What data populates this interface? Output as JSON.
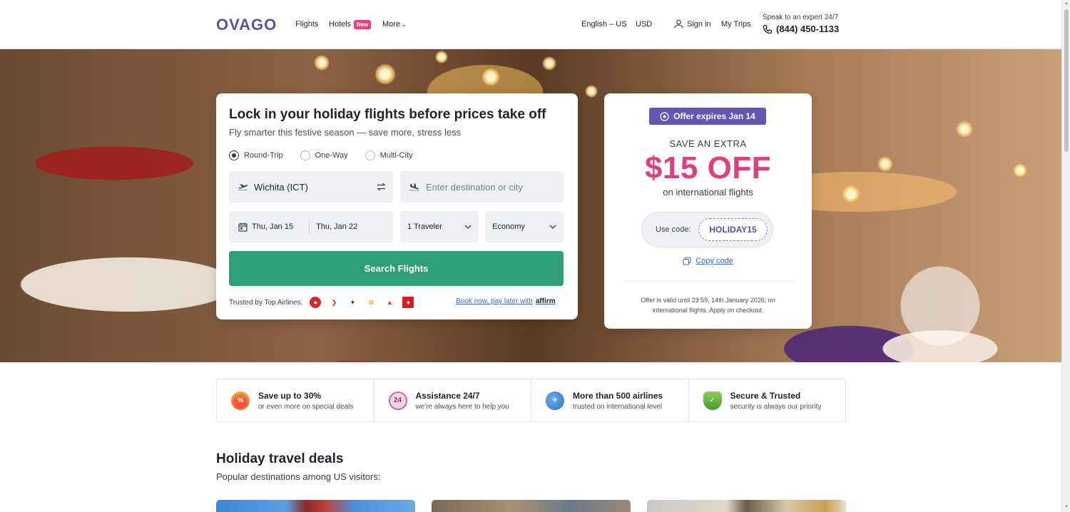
{
  "header": {
    "logo": "OVAGO",
    "nav": [
      {
        "label": "Flights"
      },
      {
        "label": "Hotels",
        "badge": "New"
      },
      {
        "label": "More"
      }
    ],
    "language": "English – US",
    "currency": "USD",
    "sign_in": "Sign in",
    "my_trips": "My Trips",
    "phone_caption": "Speak to an expert 24/7",
    "phone_number": "(844) 450-1133"
  },
  "search": {
    "title": "Lock in your holiday flights before prices take off",
    "subtitle": "Fly smarter this festive season — save more, stress less",
    "trip_types": [
      "Round-Trip",
      "One-Way",
      "Multi-City"
    ],
    "selected_trip_type": "Round-Trip",
    "origin_value": "Wichita (ICT)",
    "destination_placeholder": "Enter destination or city",
    "depart_date": "Thu, Jan 15",
    "return_date": "Thu, Jan 22",
    "travelers": "1 Traveler",
    "cabin_class": "Economy",
    "search_button": "Search Flights",
    "trusted_label": "Trusted by Top Airlines:",
    "book_later": "Book now, pay later with",
    "affirm": "affirm"
  },
  "airlines": [
    {
      "icon": "turkish-airlines-logo",
      "color": "#d7262e"
    },
    {
      "icon": "airline-logo-2",
      "color": "#d62c2c"
    },
    {
      "icon": "qatar-airways-logo",
      "color": "#5c0632"
    },
    {
      "icon": "singapore-airlines-logo",
      "color": "#f2a53a"
    },
    {
      "icon": "austrian-airlines-logo",
      "color": "#e03a3a"
    },
    {
      "icon": "emirates-logo",
      "color": "#d71a21"
    }
  ],
  "promo": {
    "offer_badge": "Offer expires Jan 14",
    "save_extra": "SAVE AN EXTRA",
    "amount": "$15 OFF",
    "scope": "on international flights",
    "use_code_label": "Use code:",
    "code": "HOLIDAY15",
    "copy_label": "Copy code",
    "terms": "Offer is valid until 23:59, 14th January 2026, on international flights. Apply on checkout.",
    "accent_color": "#e03f7f",
    "badge_color": "#6553b5"
  },
  "features": [
    {
      "title": "Save up to 30%",
      "subtitle": "or even more on special deals",
      "icon": "discount-flame-icon"
    },
    {
      "title": "Assistance 24/7",
      "subtitle": "we're always here to help you",
      "icon": "support-24-icon"
    },
    {
      "title": "More than 500 airlines",
      "subtitle": "trusted on international level",
      "icon": "globe-plane-icon"
    },
    {
      "title": "Secure & Trusted",
      "subtitle": "security is always our priority",
      "icon": "shield-check-icon"
    }
  ],
  "deals": {
    "title": "Holiday travel deals",
    "subtitle": "Popular destinations among US visitors:"
  },
  "colors": {
    "brand": "#5b4fa8",
    "search_button": "#2e9f7a",
    "link": "#4566d8"
  }
}
